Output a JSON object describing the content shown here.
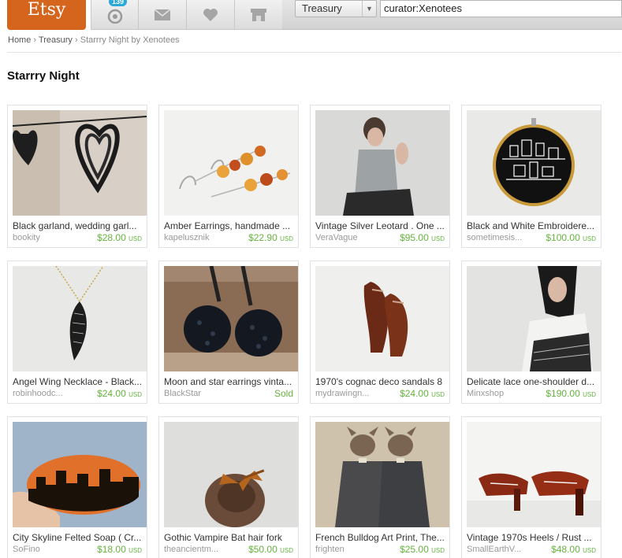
{
  "header": {
    "logo_text": "Etsy",
    "notification_count": "139",
    "search_scope": "Treasury",
    "search_value": "curator:Xenotees",
    "colors": {
      "logo": "#d5641c",
      "price": "#67b33e",
      "badge": "#2aa8d8"
    },
    "tab_icons": [
      "activity-feed-icon",
      "mail-icon",
      "heart-icon",
      "shop-icon"
    ]
  },
  "breadcrumb": {
    "home": "Home",
    "sep1": "›",
    "treasury": "Treasury",
    "sep2": "›",
    "current": "Starrry Night by Xenotees"
  },
  "page_title": "Starrry Night",
  "items": [
    {
      "title": "Black garland, wedding garl...",
      "shop": "bookity",
      "price": "$28.00",
      "currency": "USD"
    },
    {
      "title": "Amber Earrings, handmade ...",
      "shop": "kapelusznik",
      "price": "$22.90",
      "currency": "USD"
    },
    {
      "title": "Vintage Silver Leotard . One ...",
      "shop": "VeraVague",
      "price": "$95.00",
      "currency": "USD"
    },
    {
      "title": "Black and White Embroidere...",
      "shop": "sometimesis...",
      "price": "$100.00",
      "currency": "USD"
    },
    {
      "title": "Angel Wing Necklace - Black...",
      "shop": "robinhoodc...",
      "price": "$24.00",
      "currency": "USD"
    },
    {
      "title": "Moon and star earrings vinta...",
      "shop": "BlackStar",
      "price": "Sold",
      "currency": ""
    },
    {
      "title": "1970's cognac deco sandals 8",
      "shop": "mydrawingn...",
      "price": "$24.00",
      "currency": "USD"
    },
    {
      "title": "Delicate lace one-shoulder d...",
      "shop": "Minxshop",
      "price": "$190.00",
      "currency": "USD"
    },
    {
      "title": "City Skyline Felted Soap ( Cr...",
      "shop": "SoFino",
      "price": "$18.00",
      "currency": "USD"
    },
    {
      "title": "Gothic Vampire Bat hair fork",
      "shop": "theancientm...",
      "price": "$50.00",
      "currency": "USD"
    },
    {
      "title": "French Bulldog Art Print, The...",
      "shop": "frighten",
      "price": "$25.00",
      "currency": "USD"
    },
    {
      "title": "Vintage 1970s Heels / Rust ...",
      "shop": "SmallEarthV...",
      "price": "$48.00",
      "currency": "USD"
    }
  ]
}
